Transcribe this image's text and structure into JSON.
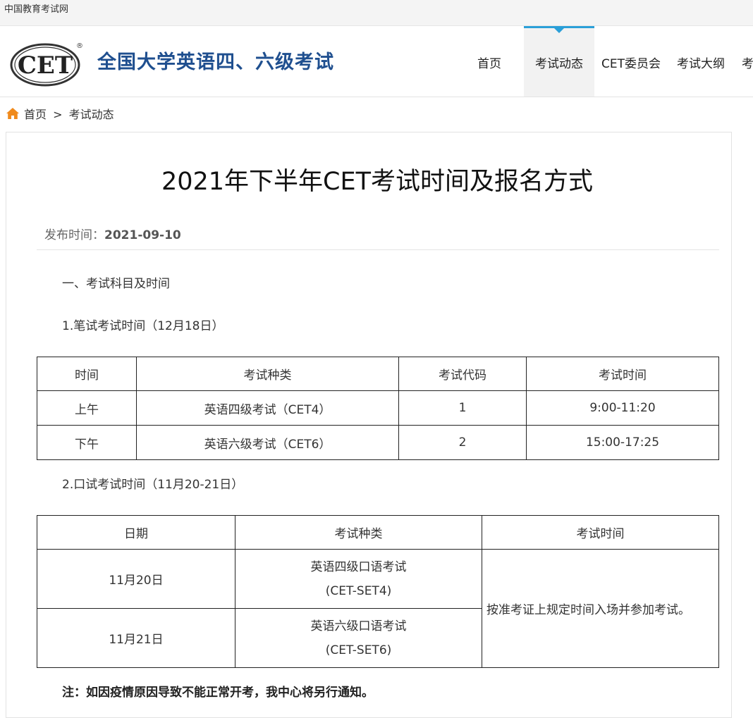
{
  "topbar": {
    "site_name": "中国教育考试网"
  },
  "header": {
    "logo_text": "CET",
    "logo_registered": "®",
    "brand": "全国大学英语四、六级考试",
    "nav": [
      "首页",
      "考试动态",
      "CET委员会",
      "考试大纲",
      "考"
    ],
    "nav_active": "考试动态"
  },
  "breadcrumb": {
    "home": "首页",
    "separator": ">",
    "current": "考试动态"
  },
  "article": {
    "title": "2021年下半年CET考试时间及报名方式",
    "published_label": "发布时间：",
    "published_date": "2021-09-10",
    "section1": "一、考试科目及时间",
    "written_heading": "1.笔试考试时间（12月18日）",
    "written_table": {
      "headers": [
        "时间",
        "考试种类",
        "考试代码",
        "考试时间"
      ],
      "rows": [
        [
          "上午",
          "英语四级考试（CET4）",
          "1",
          "9:00-11:20"
        ],
        [
          "下午",
          "英语六级考试（CET6）",
          "2",
          "15:00-17:25"
        ]
      ]
    },
    "oral_heading": "2.口试考试时间（11月20-21日）",
    "oral_table": {
      "headers": [
        "日期",
        "考试种类",
        "考试时间"
      ],
      "rows": [
        {
          "date": "11月20日",
          "type_line1": "英语四级口语考试",
          "type_line2": "(CET-SET4)"
        },
        {
          "date": "11月21日",
          "type_line1": "英语六级口语考试",
          "type_line2": "(CET-SET6)"
        }
      ],
      "time_note": "按准考证上规定时间入场并参加考试。"
    },
    "note": "注：如因疫情原因导致不能正常开考，我中心将另行通知。"
  },
  "colors": {
    "brand_blue": "#1f4f8f",
    "nav_accent": "#2a9fd8",
    "home_icon": "#f08a1c"
  },
  "icons": {
    "home": "home-icon"
  }
}
